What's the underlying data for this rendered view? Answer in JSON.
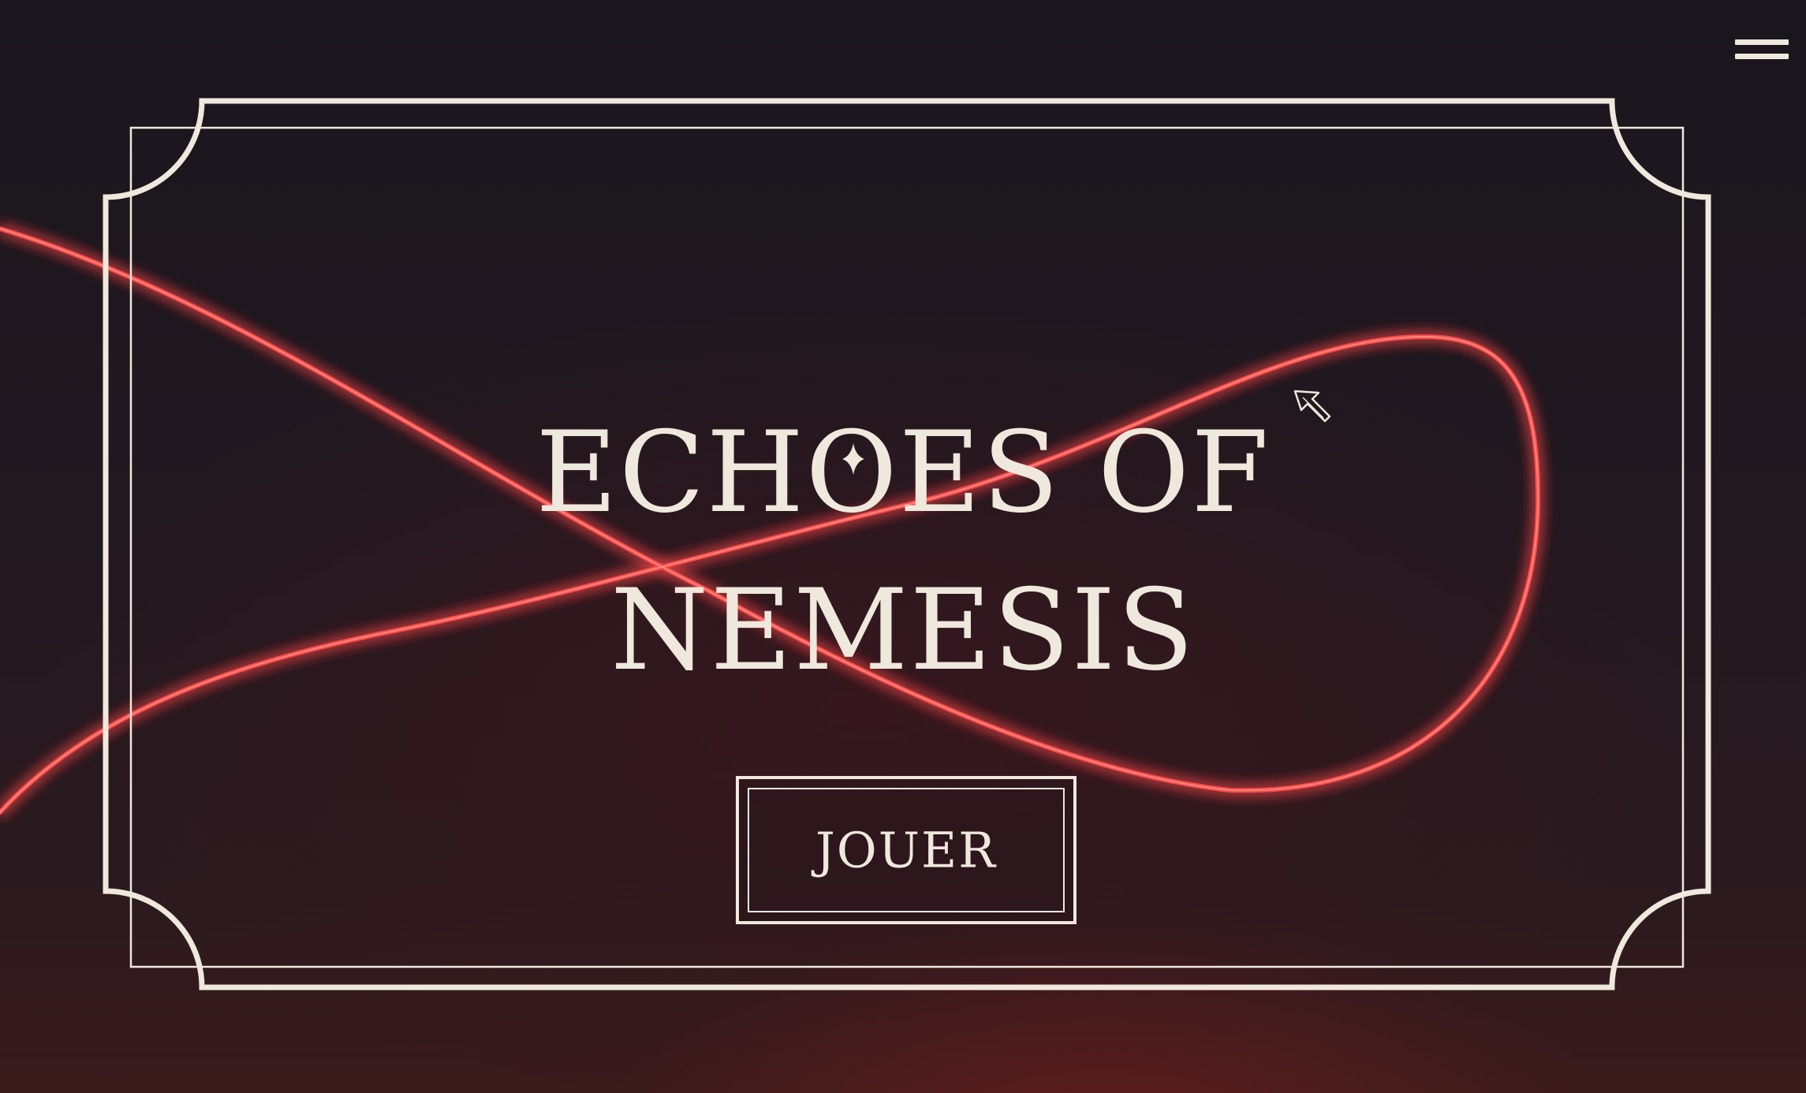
{
  "game": {
    "title_line_1": "ECHOES OF",
    "title_line_2": "NEMESIS",
    "play_label": "JOUER"
  },
  "menu": {
    "icon": "hamburger-menu-icon"
  },
  "colors": {
    "background": "#1b161c",
    "frame": "#efe8dc",
    "neon": "#ff4a4a",
    "text": "#efe8dc"
  }
}
